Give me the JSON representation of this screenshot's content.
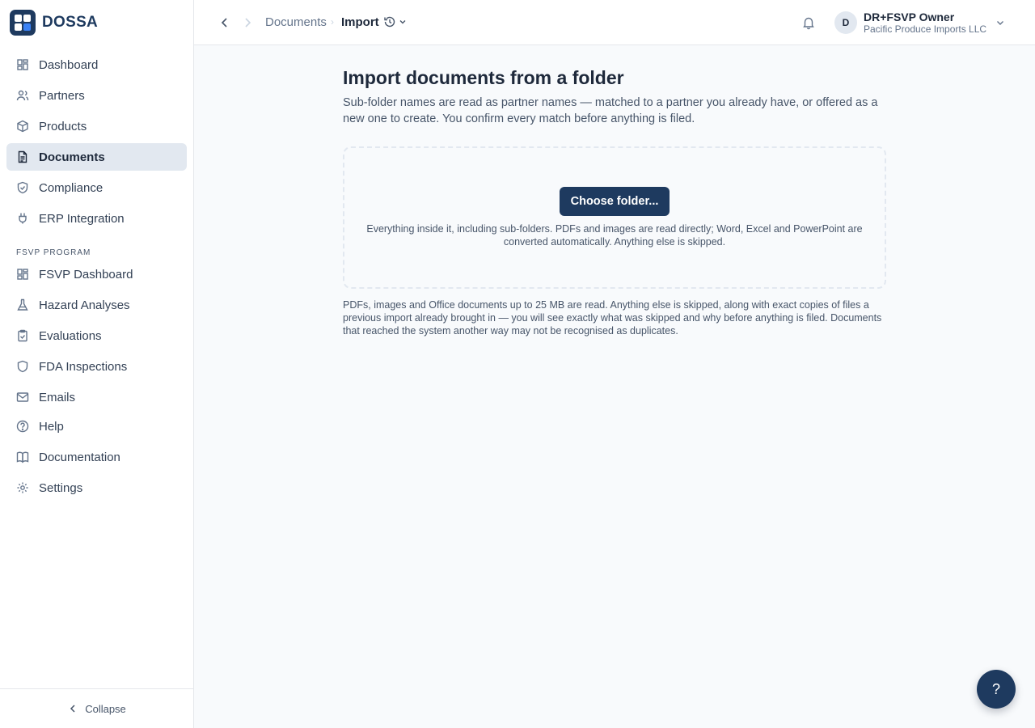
{
  "app": {
    "name": "DOSSA"
  },
  "sidebar": {
    "items": [
      {
        "label": "Dashboard",
        "icon": "dashboard-icon"
      },
      {
        "label": "Partners",
        "icon": "users-icon"
      },
      {
        "label": "Products",
        "icon": "box-icon"
      },
      {
        "label": "Documents",
        "icon": "document-icon",
        "active": true
      },
      {
        "label": "Compliance",
        "icon": "shield-check-icon"
      },
      {
        "label": "ERP Integration",
        "icon": "plug-icon"
      }
    ],
    "section_label": "FSVP PROGRAM",
    "fsvp_items": [
      {
        "label": "FSVP Dashboard",
        "icon": "dashboard-icon"
      },
      {
        "label": "Hazard Analyses",
        "icon": "flask-icon"
      },
      {
        "label": "Evaluations",
        "icon": "clipboard-check-icon"
      },
      {
        "label": "FDA Inspections",
        "icon": "shield-icon"
      },
      {
        "label": "Emails",
        "icon": "mail-icon"
      },
      {
        "label": "Help",
        "icon": "help-circle-icon"
      },
      {
        "label": "Documentation",
        "icon": "book-icon"
      },
      {
        "label": "Settings",
        "icon": "gear-icon"
      }
    ],
    "collapse_label": "Collapse"
  },
  "header": {
    "breadcrumb": [
      "Documents",
      "Import"
    ],
    "user": {
      "initial": "D",
      "name": "DR+FSVP Owner",
      "org": "Pacific Produce Imports LLC"
    }
  },
  "main": {
    "title": "Import documents from a folder",
    "description": "Sub-folder names are read as partner names — matched to a partner you already have, or offered as a new one to create. You confirm every match before anything is filed.",
    "choose_button": "Choose folder...",
    "drop_hint": "Everything inside it, including sub-folders. PDFs and images are read directly; Word, Excel and PowerPoint are converted automatically. Anything else is skipped.",
    "footnote": "PDFs, images and Office documents up to 25 MB are read. Anything else is skipped, along with exact copies of files a previous import already brought in — you will see exactly what was skipped and why before anything is filed. Documents that reached the system another way may not be recognised as duplicates."
  },
  "help_fab": {
    "label": "?"
  },
  "colors": {
    "brand": "#1e3a5f",
    "accent": "#3b82f6",
    "active_bg": "#e2e8f0"
  }
}
